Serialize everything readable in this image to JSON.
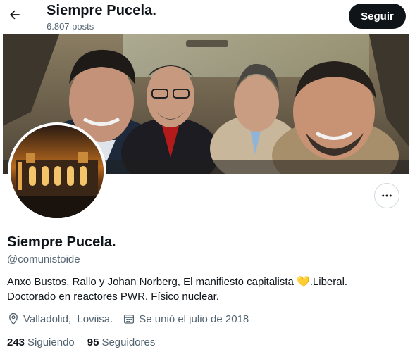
{
  "header": {
    "title": "Siempre Pucela.",
    "posts": "6.807 posts",
    "follow_label": "Seguir"
  },
  "profile": {
    "name": "Siempre Pucela.",
    "handle": "@comunistoide",
    "bio_line1_before_emoji": "Anxo Bustos, Rallo y Johan Norberg, El manifiesto capitalista ",
    "bio_emoji": "💛",
    "bio_line1_after_emoji": ".Liberal.",
    "bio_line2": "Doctorado en reactores PWR. Físico nuclear.",
    "location": "Valladolid,  Loviisa.",
    "joined": "Se unió el julio de 2018",
    "following_count": "243",
    "following_label": "Siguiendo",
    "followers_count": "95",
    "followers_label": "Seguidores"
  },
  "icons": {
    "back": "arrow-left-icon",
    "more": "more-horizontal-icon",
    "location": "location-pin-icon",
    "calendar": "calendar-icon"
  },
  "colors": {
    "follow_button_bg": "#0f1419",
    "secondary_text": "#536471",
    "heart_emoji": "#f4c542"
  }
}
